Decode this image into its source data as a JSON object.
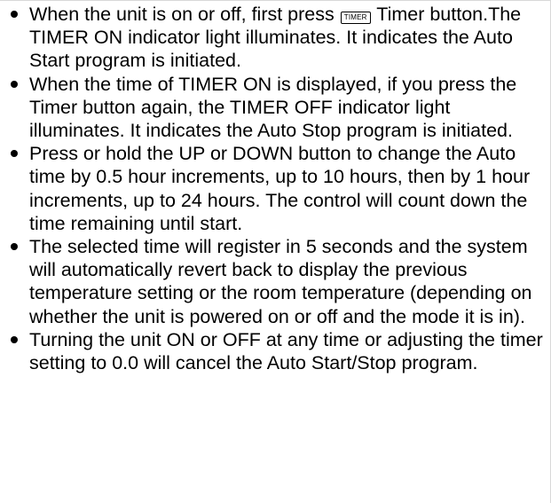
{
  "button_icon": {
    "timer_label": "TIMER"
  },
  "instructions": [
    {
      "before_icon": "When the unit is on or off, first press",
      "after_icon": " Timer button.The TIMER ON indicator light illuminates. It indicates the Auto Start program is initiated."
    },
    {
      "text": "When the time of TIMER ON is displayed, if you press the Timer button again, the TIMER OFF indicator light illuminates. It indicates the Auto Stop program is initiated."
    },
    {
      "text": "Press or hold the UP or DOWN button to change the Auto time by 0.5 hour increments, up to 10 hours, then by 1 hour increments, up to 24 hours. The control will count down the time remaining until start."
    },
    {
      "text": "The selected time will register in 5 seconds and the system will automatically revert back to display the previous temperature setting or the room temperature (depending on whether the unit is powered on or off and the mode it is in)."
    },
    {
      "text": "Turning the unit ON or OFF at any time or adjusting the timer setting to 0.0 will cancel the Auto Start/Stop program."
    }
  ]
}
